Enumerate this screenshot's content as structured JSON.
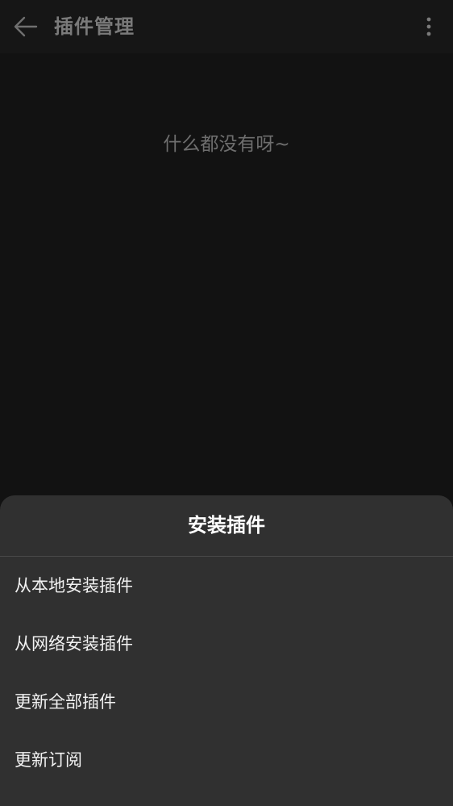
{
  "app_bar": {
    "title": "插件管理",
    "back_icon": "arrow-left-icon",
    "more_icon": "more-vertical-icon"
  },
  "main": {
    "empty_message": "什么都没有呀~"
  },
  "bottom_sheet": {
    "title": "安装插件",
    "items": [
      {
        "label": "从本地安装插件"
      },
      {
        "label": "从网络安装插件"
      },
      {
        "label": "更新全部插件"
      },
      {
        "label": "更新订阅"
      }
    ]
  },
  "colors": {
    "background": "#121212",
    "app_bar": "#161616",
    "sheet": "#303030",
    "title_text": "#7a7a7a",
    "sheet_text": "#f2f2f2"
  }
}
